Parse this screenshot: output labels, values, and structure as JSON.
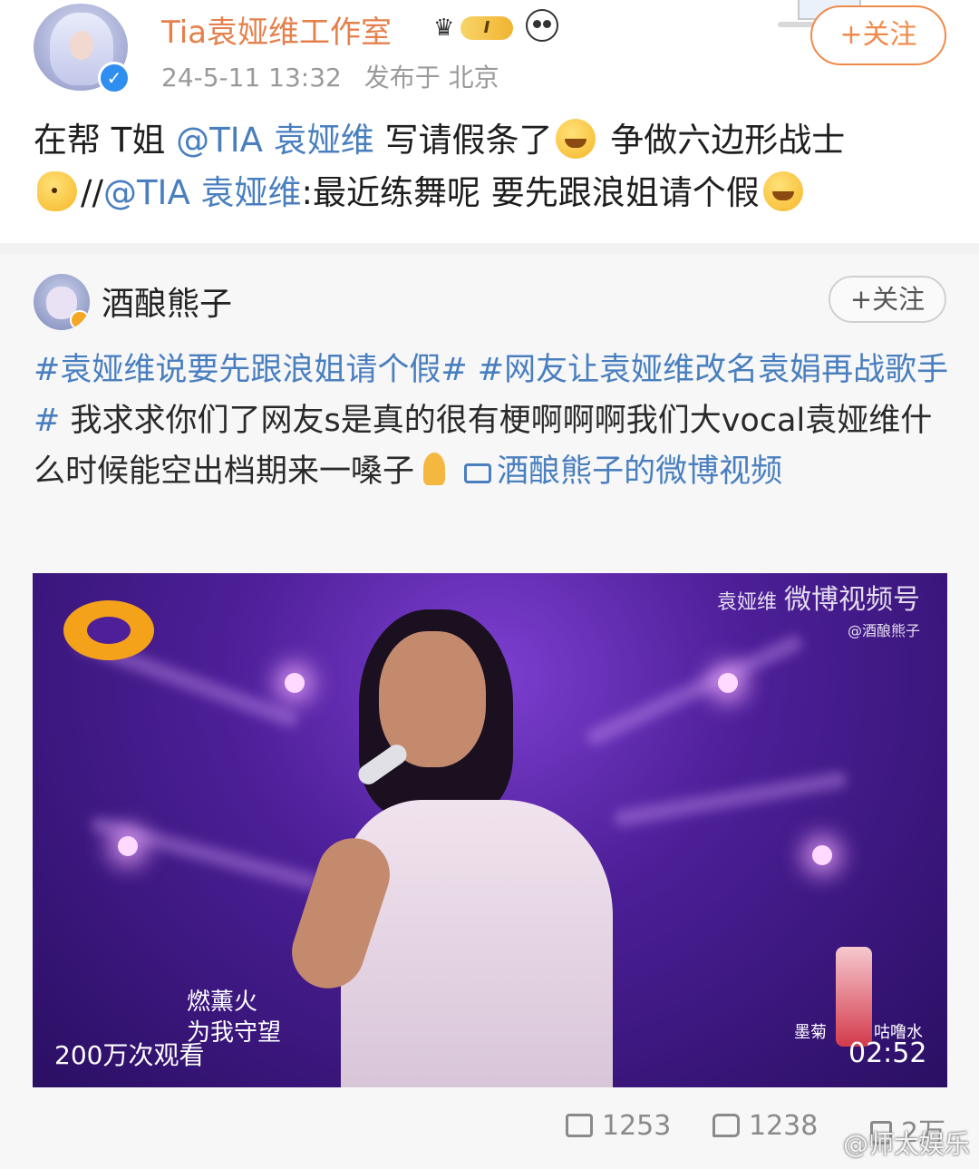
{
  "post": {
    "author": "Tia袁娅维工作室",
    "vip_level": "I",
    "timestamp": "24-5-11 13:32",
    "location": "发布于 北京",
    "follow_label": "+关注",
    "text": {
      "line1_pre": "在帮 T姐 ",
      "mention": "@TIA 袁娅维",
      "line1_post": " 写请假条了",
      "line1_tail": " 争做六边形战士",
      "line2_sep": "//",
      "line2_mention": "@TIA 袁娅维",
      "line2_text": ":最近练舞呢 要先跟浪姐请个假"
    }
  },
  "repost": {
    "author": "酒酿熊子",
    "follow_label": "+关注",
    "tag1": "#袁娅维说要先跟浪姐请个假#",
    "tag2": "#网友让袁娅维改名袁娟再战歌手#",
    "body": " 我求求你们了网友s是真的很有梗啊啊啊我们大vocal袁娅维什么时候能空出档期来一嗓子",
    "video_link": "酒酿熊子的微博视频"
  },
  "video": {
    "watermark_name": "袁娅维",
    "watermark_channel": "微博视频号",
    "watermark_handle": "@酒酿熊子",
    "lyric_line1": "燃薰火",
    "lyric_line2": "为我守望",
    "views": "200万次观看",
    "product_label_a": "墨菊",
    "product_label_b": "咕噜水",
    "duration": "02:52"
  },
  "actions": {
    "repost_count": "1253",
    "comment_count": "1238",
    "like_count": "2万"
  },
  "footer_watermark": "@师太娱乐",
  "colors": {
    "author_orange": "#e5804c",
    "link_blue": "#4a7fbf",
    "follow_orange": "#f08a4b"
  }
}
